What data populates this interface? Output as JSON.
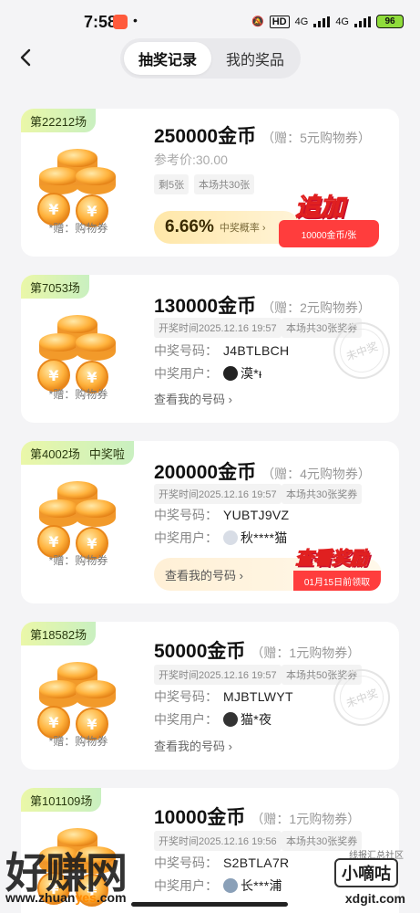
{
  "status_bar": {
    "time": "7:58",
    "battery": "96",
    "network_1": "4G",
    "network_2": "4G",
    "hd": "HD"
  },
  "header": {
    "tab_active": "抽奖记录",
    "tab_other": "我的奖品"
  },
  "cards": [
    {
      "round": "第22212场",
      "title": "250000金币",
      "gift": "（赠：5元购物券）",
      "ref_price": "参考价:30.00",
      "chip_left": "剩5张",
      "chip_total": "本场共30张",
      "coin_label": "*赠：购物券",
      "probability": "6.66%",
      "probability_label": "中奖概率 ›",
      "add_button": "追加",
      "add_button_sub": "10000金币/张"
    },
    {
      "round": "第7053场",
      "title": "130000金币",
      "gift": "（赠：2元购物券）",
      "open_time": "开奖时间2025.12.16 19:57",
      "chip_total": "本场共30张奖券",
      "coin_label": "*赠：购物券",
      "win_code_label": "中奖号码：",
      "win_code": "J4BTLBCH",
      "win_user_label": "中奖用户：",
      "win_user": "漠*ᵻ",
      "view_codes": "查看我的号码 ›",
      "stamp": "未中奖"
    },
    {
      "round": "第4002场",
      "won_tag": "中奖啦",
      "title": "200000金币",
      "gift": "（赠：4元购物券）",
      "open_time": "开奖时间2025.12.16 19:57",
      "chip_total": "本场共30张奖券",
      "coin_label": "*赠：购物券",
      "win_code_label": "中奖号码：",
      "win_code": "YUBTJ9VZ",
      "win_user_label": "中奖用户：",
      "win_user": "秋****猫",
      "view_codes": "查看我的号码 ›",
      "reward_button": "查看奖励",
      "reward_sub": "01月15日前领取"
    },
    {
      "round": "第18582场",
      "title": "50000金币",
      "gift": "（赠：1元购物券）",
      "open_time": "开奖时间2025.12.16 19:57",
      "chip_total": "本场共50张奖券",
      "coin_label": "*赠：购物券",
      "win_code_label": "中奖号码：",
      "win_code": "MJBTLWYT",
      "win_user_label": "中奖用户：",
      "win_user": "猫*夜",
      "view_codes": "查看我的号码 ›",
      "stamp": "未中奖"
    },
    {
      "round": "第101109场",
      "title": "10000金币",
      "gift": "（赠：1元购物券）",
      "open_time": "开奖时间2025.12.16 19:56",
      "chip_total": "本场共30张奖券",
      "win_code_label": "中奖号码：",
      "win_code": "S2BTLA7R",
      "win_user_label": "中奖用户：",
      "win_user": "长***浦"
    }
  ],
  "watermark": {
    "left_text": "好赚网",
    "left_url_a": "www.zhuan",
    "left_url_b": "yes",
    "left_url_c": ".com",
    "right_text": "小嘀咕",
    "right_small": "线报汇总社区",
    "right_url": "xdgit.com"
  }
}
